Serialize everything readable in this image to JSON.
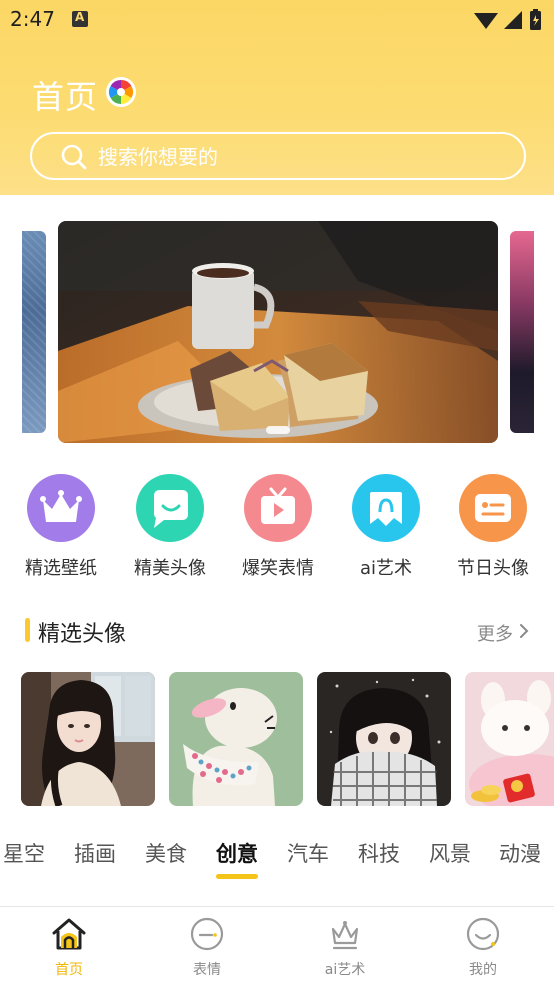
{
  "status_bar": {
    "time": "2:47"
  },
  "header": {
    "title": "首页"
  },
  "search": {
    "placeholder": "搜索你想要的"
  },
  "quick_actions": [
    {
      "label": "精选壁纸",
      "icon": "crown-icon",
      "color": "#a27ce8"
    },
    {
      "label": "精美头像",
      "icon": "smile-bubble-icon",
      "color": "#2ed5b3"
    },
    {
      "label": "爆笑表情",
      "icon": "tv-play-icon",
      "color": "#f48a8f"
    },
    {
      "label": "ai艺术",
      "icon": "ai-art-icon",
      "color": "#28c6ec"
    },
    {
      "label": "节日头像",
      "icon": "card-icon",
      "color": "#f7954a"
    }
  ],
  "section": {
    "title": "精选头像",
    "more": "更多"
  },
  "categories": {
    "items": [
      "星空",
      "插画",
      "美食",
      "创意",
      "汽车",
      "科技",
      "风景",
      "动漫"
    ],
    "active": "创意"
  },
  "bottom_nav": [
    {
      "label": "首页",
      "icon": "home-icon",
      "active": true
    },
    {
      "label": "表情",
      "icon": "emoji-icon",
      "active": false
    },
    {
      "label": "ai艺术",
      "icon": "crown-outline-icon",
      "active": false
    },
    {
      "label": "我的",
      "icon": "profile-icon",
      "active": false
    }
  ],
  "colors": {
    "accent": "#f4c419",
    "header": "#fcd86e"
  }
}
